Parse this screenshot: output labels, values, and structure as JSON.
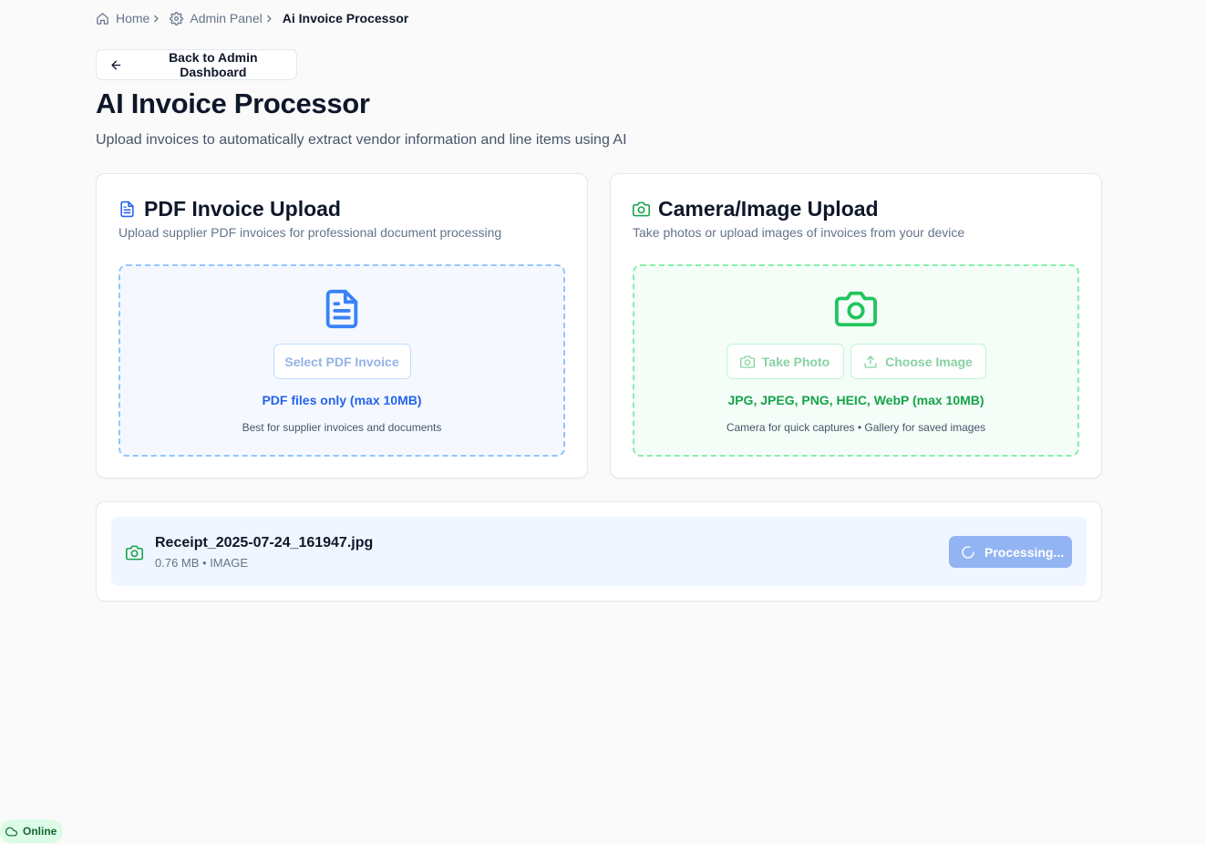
{
  "breadcrumb": {
    "home": "Home",
    "admin": "Admin Panel",
    "current": "Ai Invoice Processor"
  },
  "back_button": {
    "label": "Back to Admin Dashboard"
  },
  "page": {
    "title": "AI Invoice Processor",
    "subtitle": "Upload invoices to automatically extract vendor information and line items using AI"
  },
  "pdf_card": {
    "title": "PDF Invoice Upload",
    "description": "Upload supplier PDF invoices for professional document processing",
    "select_button": "Select PDF Invoice",
    "formats": "PDF files only (max 10MB)",
    "hint": "Best for supplier invoices and documents"
  },
  "camera_card": {
    "title": "Camera/Image Upload",
    "description": "Take photos or upload images of invoices from your device",
    "take_photo_button": "Take Photo",
    "choose_image_button": "Choose Image",
    "formats": "JPG, JPEG, PNG, HEIC, WebP (max 10MB)",
    "hint": "Camera for quick captures • Gallery for saved images"
  },
  "queue": {
    "file_name": "Receipt_2025-07-24_161947.jpg",
    "file_meta": "0.76 MB • IMAGE",
    "status_button": "Processing..."
  },
  "connection": {
    "label": "Online"
  },
  "colors": {
    "pdf_accent": "#2563eb",
    "camera_accent": "#16a34a",
    "processing_button": "#93b4f3",
    "online_badge": "#dcfce7"
  },
  "icons": {
    "breadcrumb_home": "home-icon",
    "breadcrumb_admin": "gear-icon",
    "back": "arrow-left-icon",
    "pdf": "file-text-icon",
    "camera": "camera-icon",
    "choose": "upload-icon",
    "processing": "spinner-icon",
    "online": "cloud-icon"
  }
}
